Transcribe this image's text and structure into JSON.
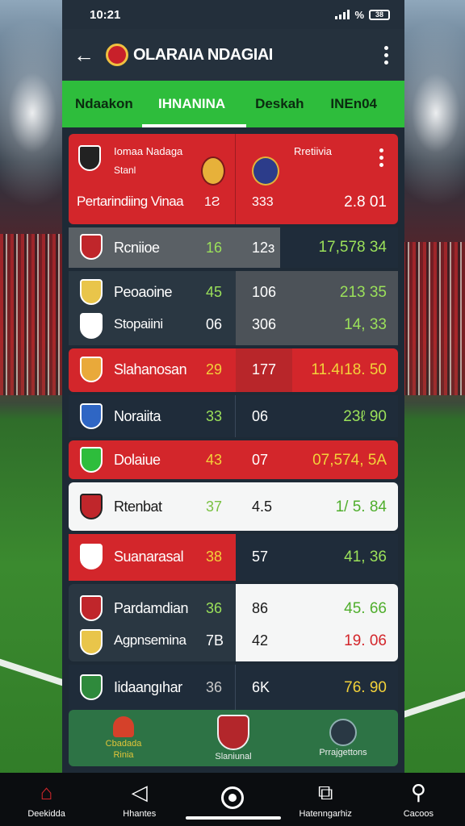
{
  "status": {
    "time": "10:21",
    "battery": "38",
    "extra": "%"
  },
  "appbar": {
    "title": "OLARAIA NDAGIAI",
    "back_icon": "arrow-left-icon",
    "menu_icon": "kebab-icon"
  },
  "tabs": [
    {
      "label": "Ndaakon",
      "active": false
    },
    {
      "label": "IHNANINA",
      "active": true
    },
    {
      "label": "Deskah",
      "active": false
    },
    {
      "label": "INEn04",
      "active": false
    }
  ],
  "header_card": {
    "team_line1": "Iomaa Nadaga",
    "team_line2": "Stanl",
    "opponent": "Rretiivia",
    "row_label": "Pertarindiing Vinaa",
    "col1": "1Ƨ",
    "col2": "333",
    "col3": "2.8 01"
  },
  "rows": [
    {
      "name": "Rcniioe",
      "a": "16",
      "b": "12ɜ",
      "c": "17,578  34"
    },
    {
      "name": "Peoaoine",
      "a": "45",
      "b": "106",
      "c": "213 35",
      "name2": "Stopaiini",
      "a2": "06",
      "b2": "306",
      "c2": "14, 33"
    },
    {
      "name": "Slahanosan",
      "a": "29",
      "b": "177",
      "c": "11.4ı18. 50"
    },
    {
      "name": "Noraiita",
      "a": "33",
      "b": "06",
      "c": "23ℓ 90"
    },
    {
      "name": "Dolaiue",
      "a": "43",
      "b": "07",
      "c": "07,574,  5A"
    },
    {
      "name": "Rtenbat",
      "a": "37",
      "b": "4.5",
      "c": "1/ 5. 84"
    },
    {
      "name": "Suanarasal",
      "a": "38",
      "b": "57",
      "c": "41, 36"
    },
    {
      "name": "Pardamdian",
      "a": "36",
      "b": "86",
      "c": "45. 66",
      "name2": "Agpnsemina",
      "a2": "7B",
      "b2": "42",
      "c2": "19. 06"
    },
    {
      "name": "Iidaangıhar",
      "a": "36",
      "b": "6K",
      "c": "76. 90"
    }
  ],
  "bottom_card": [
    {
      "line1": "Cbadada",
      "line2": "Rinia",
      "icon": "badge-icon"
    },
    {
      "line1": "Slaniunal",
      "line2": "",
      "icon": "shield-icon"
    },
    {
      "line1": "Prrajgettons",
      "line2": "",
      "icon": "globe-icon"
    }
  ],
  "navbar": [
    {
      "label": "Deekidda",
      "icon": "home-icon"
    },
    {
      "label": "Hhantes",
      "icon": "back-triangle-icon"
    },
    {
      "label": "",
      "icon": "circle-home-icon"
    },
    {
      "label": "Hatenngarhiz",
      "icon": "recents-icon"
    },
    {
      "label": "Cacoos",
      "icon": "search-icon"
    }
  ],
  "colors": {
    "red": "#d3262b",
    "green": "#2ebd3c",
    "navy": "#1f2c3a",
    "yellow": "#f3d23a",
    "lime": "#8fe04a"
  }
}
